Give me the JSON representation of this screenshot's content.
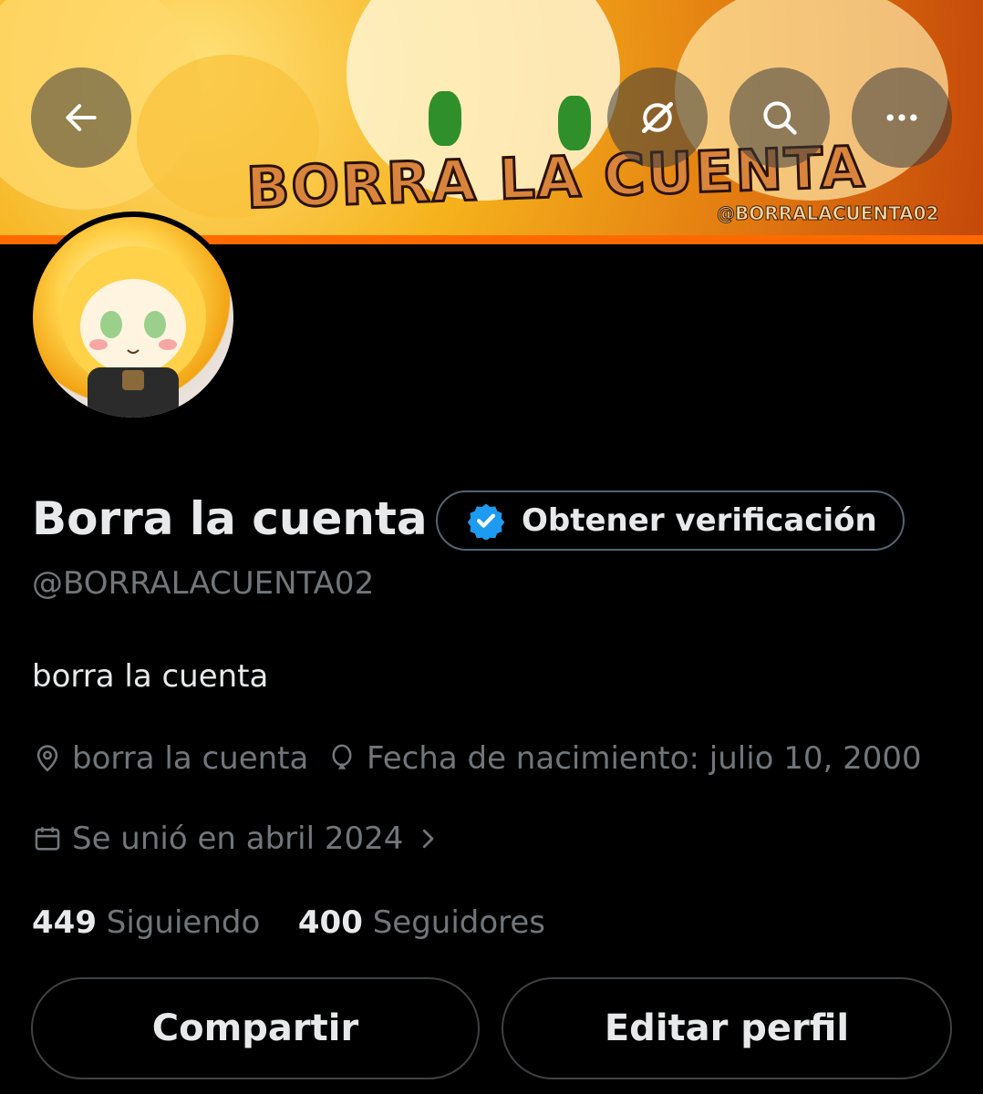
{
  "banner": {
    "title": "BORRA LA CUENTA",
    "handle": "@BORRALACUENTA02"
  },
  "toolbar": {
    "back_icon": "arrow-left-icon",
    "grok_icon": "grok-icon",
    "search_icon": "search-icon",
    "more_icon": "more-horizontal-icon"
  },
  "profile": {
    "name": "Borra la cuenta",
    "verify_label": "Obtener verificación",
    "handle": "@BORRALACUENTA02",
    "bio": "borra la cuenta",
    "location": "borra la cuenta",
    "birthday": "Fecha de nacimiento: julio 10, 2000",
    "joined": "Se unió en abril 2024",
    "following_count": "449",
    "following_label": "Siguiendo",
    "followers_count": "400",
    "followers_label": "Seguidores"
  },
  "actions": {
    "share_label": "Compartir",
    "edit_label": "Editar perfil"
  },
  "colors": {
    "background": "#000000",
    "text_primary": "#e7e9ea",
    "text_secondary": "#71767b",
    "verify_badge": "#1d9bf0",
    "banner_accent": "#ff6a00"
  }
}
